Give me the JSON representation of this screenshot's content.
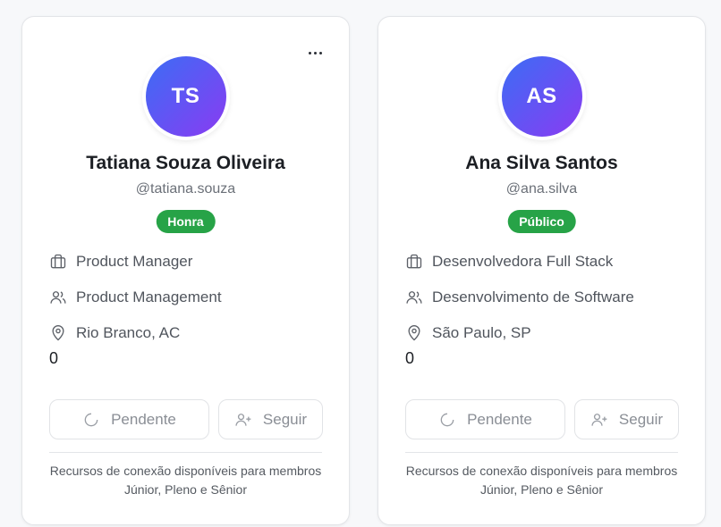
{
  "cards": [
    {
      "initials": "TS",
      "name": "Tatiana Souza Oliveira",
      "handle": "@tatiana.souza",
      "badge": "Honra",
      "role": "Product Manager",
      "department": "Product Management",
      "location": "Rio Branco, AC",
      "count": "0",
      "pending_label": "Pendente",
      "follow_label": "Seguir",
      "note": "Recursos de conexão disponíveis para membros Júnior, Pleno e Sênior",
      "show_menu": true
    },
    {
      "initials": "AS",
      "name": "Ana Silva Santos",
      "handle": "@ana.silva",
      "badge": "Público",
      "role": "Desenvolvedora Full Stack",
      "department": "Desenvolvimento de Software",
      "location": "São Paulo, SP",
      "count": "0",
      "pending_label": "Pendente",
      "follow_label": "Seguir",
      "note": "Recursos de conexão disponíveis para membros Júnior, Pleno e Sênior",
      "show_menu": false
    }
  ],
  "colors": {
    "badge_green": "#27a347",
    "avatar_gradient_start": "#3b6df5",
    "avatar_gradient_end": "#8a3bf2"
  },
  "icons": [
    "more-options-icon",
    "briefcase-icon",
    "users-icon",
    "map-pin-icon",
    "loading-icon",
    "user-plus-icon"
  ]
}
